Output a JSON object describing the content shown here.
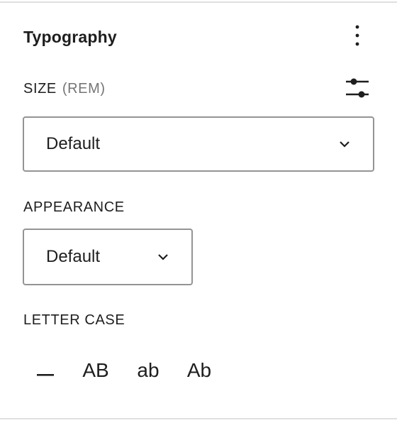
{
  "panel": {
    "title": "Typography",
    "options_icon": "more-vertical-icon"
  },
  "size": {
    "label": "SIZE",
    "unit": "(REM)",
    "settings_icon": "settings-sliders-icon",
    "select_value": "Default"
  },
  "appearance": {
    "label": "APPEARANCE",
    "select_value": "Default"
  },
  "letter_case": {
    "label": "LETTER CASE",
    "options": [
      {
        "icon": "none-dash-icon",
        "label": "–"
      },
      {
        "label": "AB"
      },
      {
        "label": "ab"
      },
      {
        "label": "Ab"
      }
    ]
  },
  "colors": {
    "text": "#1e1e1e",
    "muted": "#757575",
    "border": "#949494",
    "divider": "#e0e0e0"
  }
}
